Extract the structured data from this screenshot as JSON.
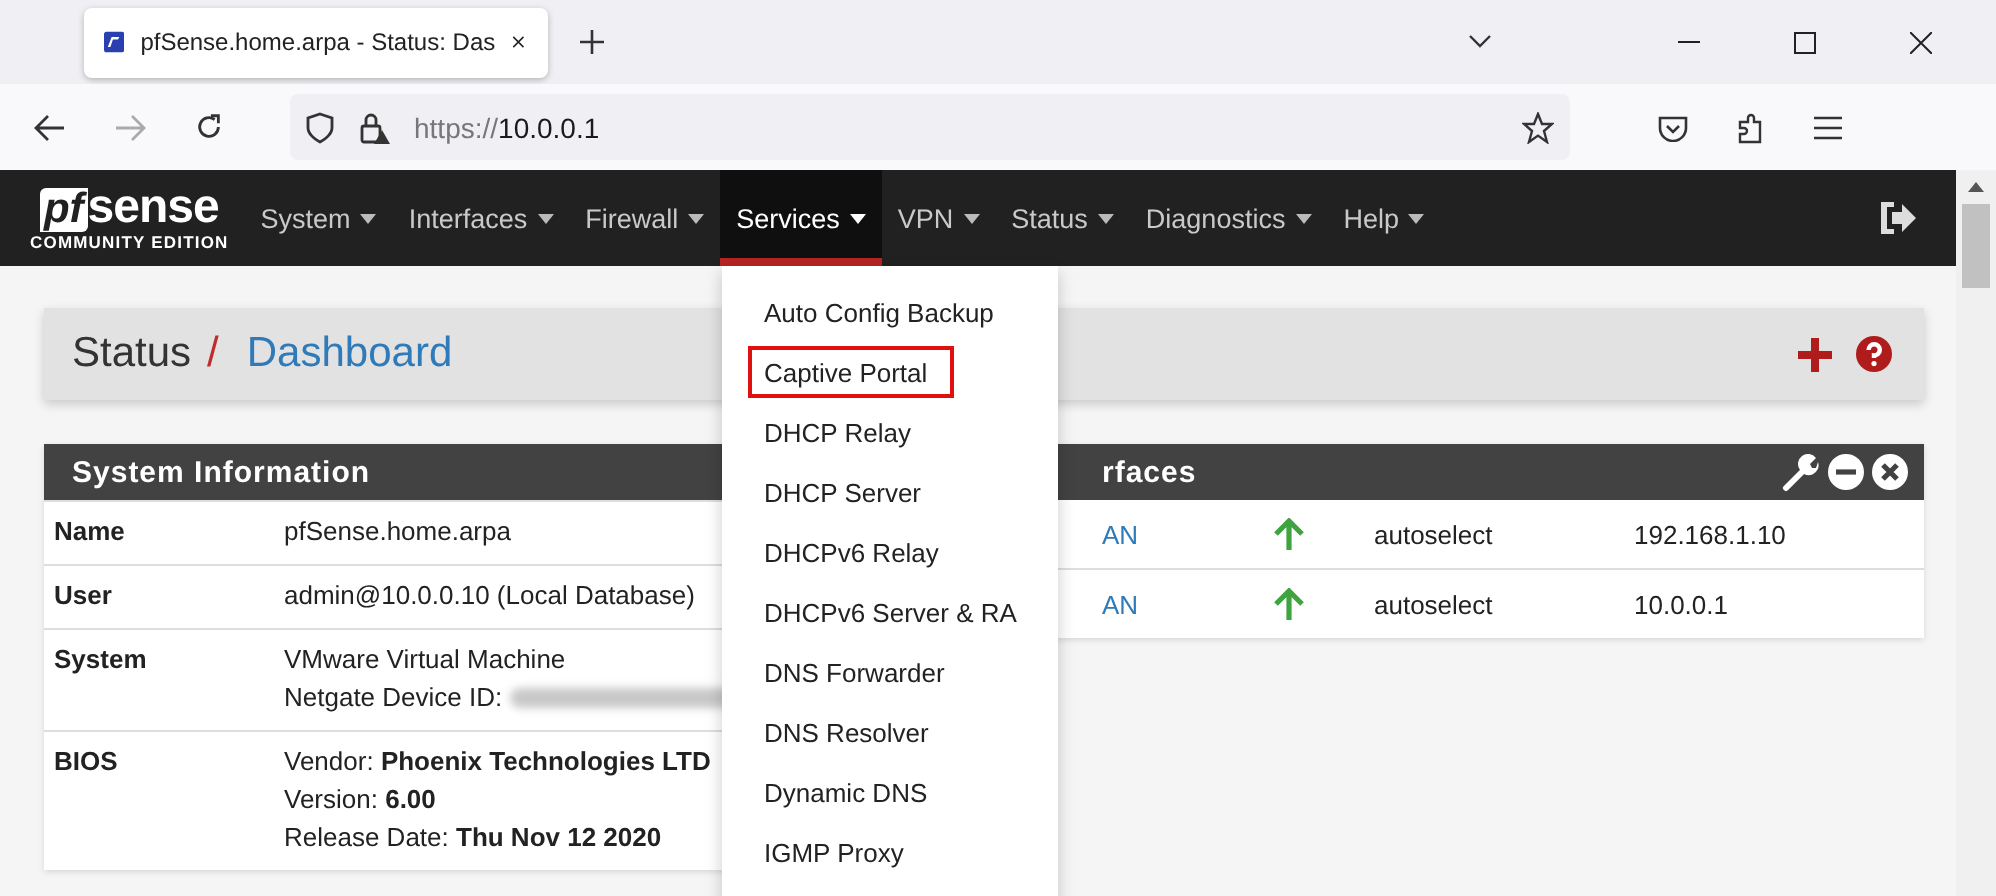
{
  "browser": {
    "tab": {
      "title": "pfSense.home.arpa - Status: Das",
      "selected": true
    },
    "url": {
      "scheme": "https://",
      "host": "10.0.0.1"
    }
  },
  "navbar": {
    "logo": {
      "brand": "sense",
      "mark": "pf",
      "edition": "COMMUNITY EDITION"
    },
    "items": [
      {
        "label": "System",
        "selected": false
      },
      {
        "label": "Interfaces",
        "selected": false
      },
      {
        "label": "Firewall",
        "selected": false
      },
      {
        "label": "Services",
        "selected": true
      },
      {
        "label": "VPN",
        "selected": false
      },
      {
        "label": "Status",
        "selected": false
      },
      {
        "label": "Diagnostics",
        "selected": false
      },
      {
        "label": "Help",
        "selected": false
      }
    ]
  },
  "dropdown": [
    {
      "label": "Auto Config Backup",
      "highlighted": false
    },
    {
      "label": "Captive Portal",
      "highlighted": true
    },
    {
      "label": "DHCP Relay",
      "highlighted": false
    },
    {
      "label": "DHCP Server",
      "highlighted": false
    },
    {
      "label": "DHCPv6 Relay",
      "highlighted": false
    },
    {
      "label": "DHCPv6 Server & RA",
      "highlighted": false
    },
    {
      "label": "DNS Forwarder",
      "highlighted": false
    },
    {
      "label": "DNS Resolver",
      "highlighted": false
    },
    {
      "label": "Dynamic DNS",
      "highlighted": false
    },
    {
      "label": "IGMP Proxy",
      "highlighted": false
    }
  ],
  "breadcrumb": {
    "parent": "Status",
    "separator": "/",
    "current": "Dashboard"
  },
  "system_information": {
    "title": "System Information",
    "rows": [
      {
        "label": "Name",
        "lines": [
          "pfSense.home.arpa"
        ]
      },
      {
        "label": "User",
        "lines": [
          "admin@10.0.0.10 (Local Database)"
        ]
      },
      {
        "label": "System",
        "lines": [
          "VMware Virtual Machine",
          "Netgate Device ID:"
        ],
        "redacted": true
      },
      {
        "label": "BIOS",
        "lines": [
          "Vendor: **Phoenix Technologies LTD**",
          "Version: **6.00**",
          "Release Date: **Thu Nov 12 2020**"
        ]
      }
    ]
  },
  "interfaces": {
    "title": "rfaces",
    "rows": [
      {
        "name": "AN",
        "up": true,
        "media": "autoselect",
        "address": "192.168.1.10"
      },
      {
        "name": "AN",
        "up": true,
        "media": "autoselect",
        "address": "10.0.0.1"
      }
    ]
  }
}
